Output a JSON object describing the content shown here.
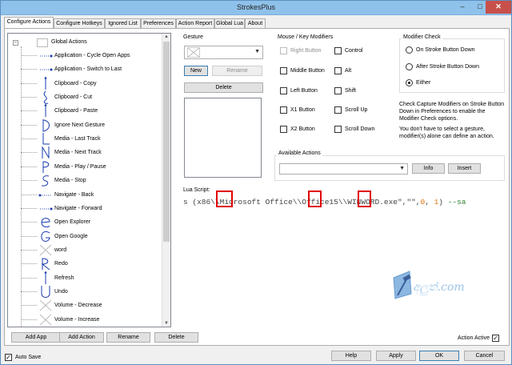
{
  "window": {
    "title": "StrokesPlus",
    "minimize": "–",
    "maximize": "□",
    "close": "✕"
  },
  "tabs": [
    "Configure Actions",
    "Configure Hotkeys",
    "Ignored List",
    "Preferences",
    "Action Report",
    "Global Lua",
    "About"
  ],
  "tree": {
    "expander": "–",
    "root": "Global Actions",
    "items": [
      {
        "label": "Application - Cycle Open Apps",
        "icon": "dotted-line-right-icon"
      },
      {
        "label": "Application - Switch to Last",
        "icon": "dotted-line-right-icon"
      },
      {
        "label": "Clipboard - Copy",
        "icon": "vertical-line-gesture-icon"
      },
      {
        "label": "Clipboard - Cut",
        "icon": "loop-gesture-icon"
      },
      {
        "label": "Clipboard - Paste",
        "icon": "vertical-line-gesture-icon"
      },
      {
        "label": "Ignore Next Gesture",
        "icon": "d-shape-gesture-icon"
      },
      {
        "label": "Media - Last Track",
        "icon": "l-shape-gesture-icon"
      },
      {
        "label": "Media - Next Track",
        "icon": "n-shape-gesture-icon"
      },
      {
        "label": "Media - Play / Pause",
        "icon": "p-shape-gesture-icon"
      },
      {
        "label": "Media - Stop",
        "icon": "s-shape-gesture-icon"
      },
      {
        "label": "Navigate - Back",
        "icon": "dotted-line-left-icon"
      },
      {
        "label": "Navigate - Forward",
        "icon": "dotted-line-right-icon"
      },
      {
        "label": "Open Explorer",
        "icon": "e-shape-gesture-icon"
      },
      {
        "label": "Open Google",
        "icon": "g-shape-gesture-icon"
      },
      {
        "label": "word",
        "icon": "x-placeholder-icon"
      },
      {
        "label": "Redo",
        "icon": "r-shape-gesture-icon"
      },
      {
        "label": "Refresh",
        "icon": "vertical-line-gesture-icon"
      },
      {
        "label": "Undo",
        "icon": "u-shape-gesture-icon"
      },
      {
        "label": "Volume - Decrease",
        "icon": "x-placeholder-icon"
      },
      {
        "label": "Volume - Increase",
        "icon": "x-placeholder-icon"
      }
    ]
  },
  "bottom_buttons": {
    "add_app": "Add App",
    "add_action": "Add Action",
    "rename": "Rename",
    "delete": "Delete"
  },
  "gesture": {
    "label": "Gesture",
    "new": "New",
    "rename": "Rename",
    "delete": "Delete"
  },
  "modifiers": {
    "label": "Mouse / Key Modifiers",
    "right_button": "Right Button",
    "middle_button": "Middle Button",
    "left_button": "Left Button",
    "x1_button": "X1 Button",
    "x2_button": "X2 Button",
    "control": "Control",
    "alt": "Alt",
    "shift": "Shift",
    "scroll_up": "Scroll Up",
    "scroll_down": "Scroll Down"
  },
  "modifier_check": {
    "label": "Modifier Check",
    "opt1": "On Stroke Button Down",
    "opt2": "After Stroke Button Down",
    "opt3": "Either",
    "selected": "Either",
    "help1": "Check Capture Modifiers on Stroke Button Down in Preferences to enable the Modifier Check options.",
    "help2": "You don't have to select a gesture, modifier(s) alone can define an action."
  },
  "available_actions": {
    "label": "Available Actions",
    "info": "Info",
    "insert": "Insert"
  },
  "lua": {
    "label": "Lua Script:",
    "code_a": "s (x86",
    "code_b": "\\\\",
    "code_c": "Microsoft Office",
    "code_d": "\\\\",
    "code_e": "Office15",
    "code_f": "\\\\",
    "code_g": "WINWORD.exe\",\"\",",
    "code_num": "0",
    "code_h": ", ",
    "code_num2": "1",
    "code_i": ") ",
    "code_comment": "--sa"
  },
  "watermark": "අලුත්.com",
  "action_active": {
    "label": "Action Active",
    "checked": true
  },
  "auto_save": {
    "label": "Auto Save",
    "checked": true
  },
  "footer": {
    "help": "Help",
    "apply": "Apply",
    "ok": "OK",
    "cancel": "Cancel"
  },
  "colors": {
    "titlebar": "#8fc2ea",
    "close": "#c7504b",
    "highlight": "#e00000",
    "gesture_stroke": "#1a3cb0"
  }
}
